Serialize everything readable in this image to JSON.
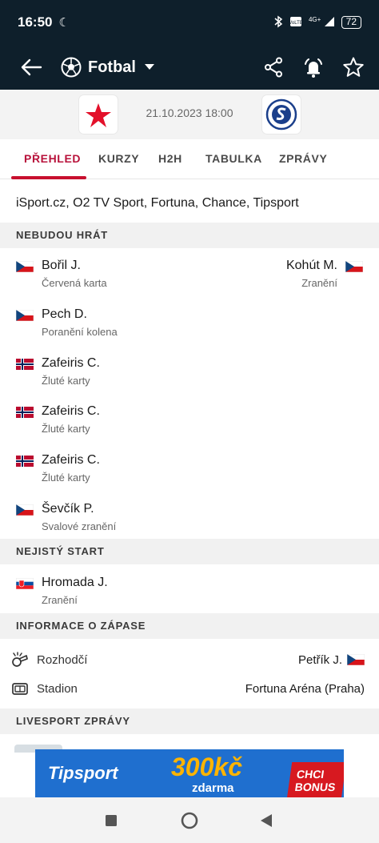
{
  "status_bar": {
    "time": "16:50",
    "network": "4G+",
    "battery": "72",
    "icons": [
      "moon-icon",
      "bluetooth-icon",
      "volte-icon",
      "signal-icon",
      "battery-icon"
    ]
  },
  "toolbar": {
    "sport": "Fotbal",
    "icons": [
      "back-arrow-icon",
      "football-icon",
      "caret-down-icon",
      "share-icon",
      "bell-icon",
      "star-icon"
    ]
  },
  "match": {
    "datetime": "21.10.2023 18:00",
    "home_logo": "slavia-crest-icon",
    "away_logo": "slovacko-crest-icon"
  },
  "tabs": [
    {
      "label": "PŘEHLED",
      "active": true
    },
    {
      "label": "KURZY",
      "active": false
    },
    {
      "label": "H2H",
      "active": false
    },
    {
      "label": "TABULKA",
      "active": false
    },
    {
      "label": "ZPRÁVY",
      "active": false
    }
  ],
  "tv": "iSport.cz, O2 TV Sport, Fortuna, Chance, Tipsport",
  "missing": {
    "header": "NEBUDOU HRÁT",
    "home": [
      {
        "name": "Bořil J.",
        "reason": "Červená karta",
        "flag": "cz"
      },
      {
        "name": "Pech D.",
        "reason": "Poranění kolena",
        "flag": "cz"
      },
      {
        "name": "Zafeiris C.",
        "reason": "Žluté karty",
        "flag": "no"
      },
      {
        "name": "Zafeiris C.",
        "reason": "Žluté karty",
        "flag": "no"
      },
      {
        "name": "Zafeiris C.",
        "reason": "Žluté karty",
        "flag": "no"
      },
      {
        "name": "Ševčík P.",
        "reason": "Svalové zranění",
        "flag": "cz"
      }
    ],
    "away": [
      {
        "name": "Kohút M.",
        "reason": "Zranění",
        "flag": "cz"
      }
    ]
  },
  "doubtful": {
    "header": "NEJISTÝ START",
    "home": [
      {
        "name": "Hromada J.",
        "reason": "Zranění",
        "flag": "sk"
      }
    ]
  },
  "info": {
    "header": "INFORMACE O ZÁPASE",
    "referee_label": "Rozhodčí",
    "referee_value": "Petřík J.",
    "stadium_label": "Stadion",
    "stadium_value": "Fortuna Aréna (Praha)"
  },
  "news": {
    "header": "LIVESPORT ZPRÁVY"
  },
  "ad": {
    "brand": "Tipsport",
    "amount": "300kč",
    "amount_sub": "zdarma",
    "cta": "CHCI BONUS"
  },
  "colors": {
    "dark_header": "#0e1f2b",
    "accent": "#c8102e"
  }
}
